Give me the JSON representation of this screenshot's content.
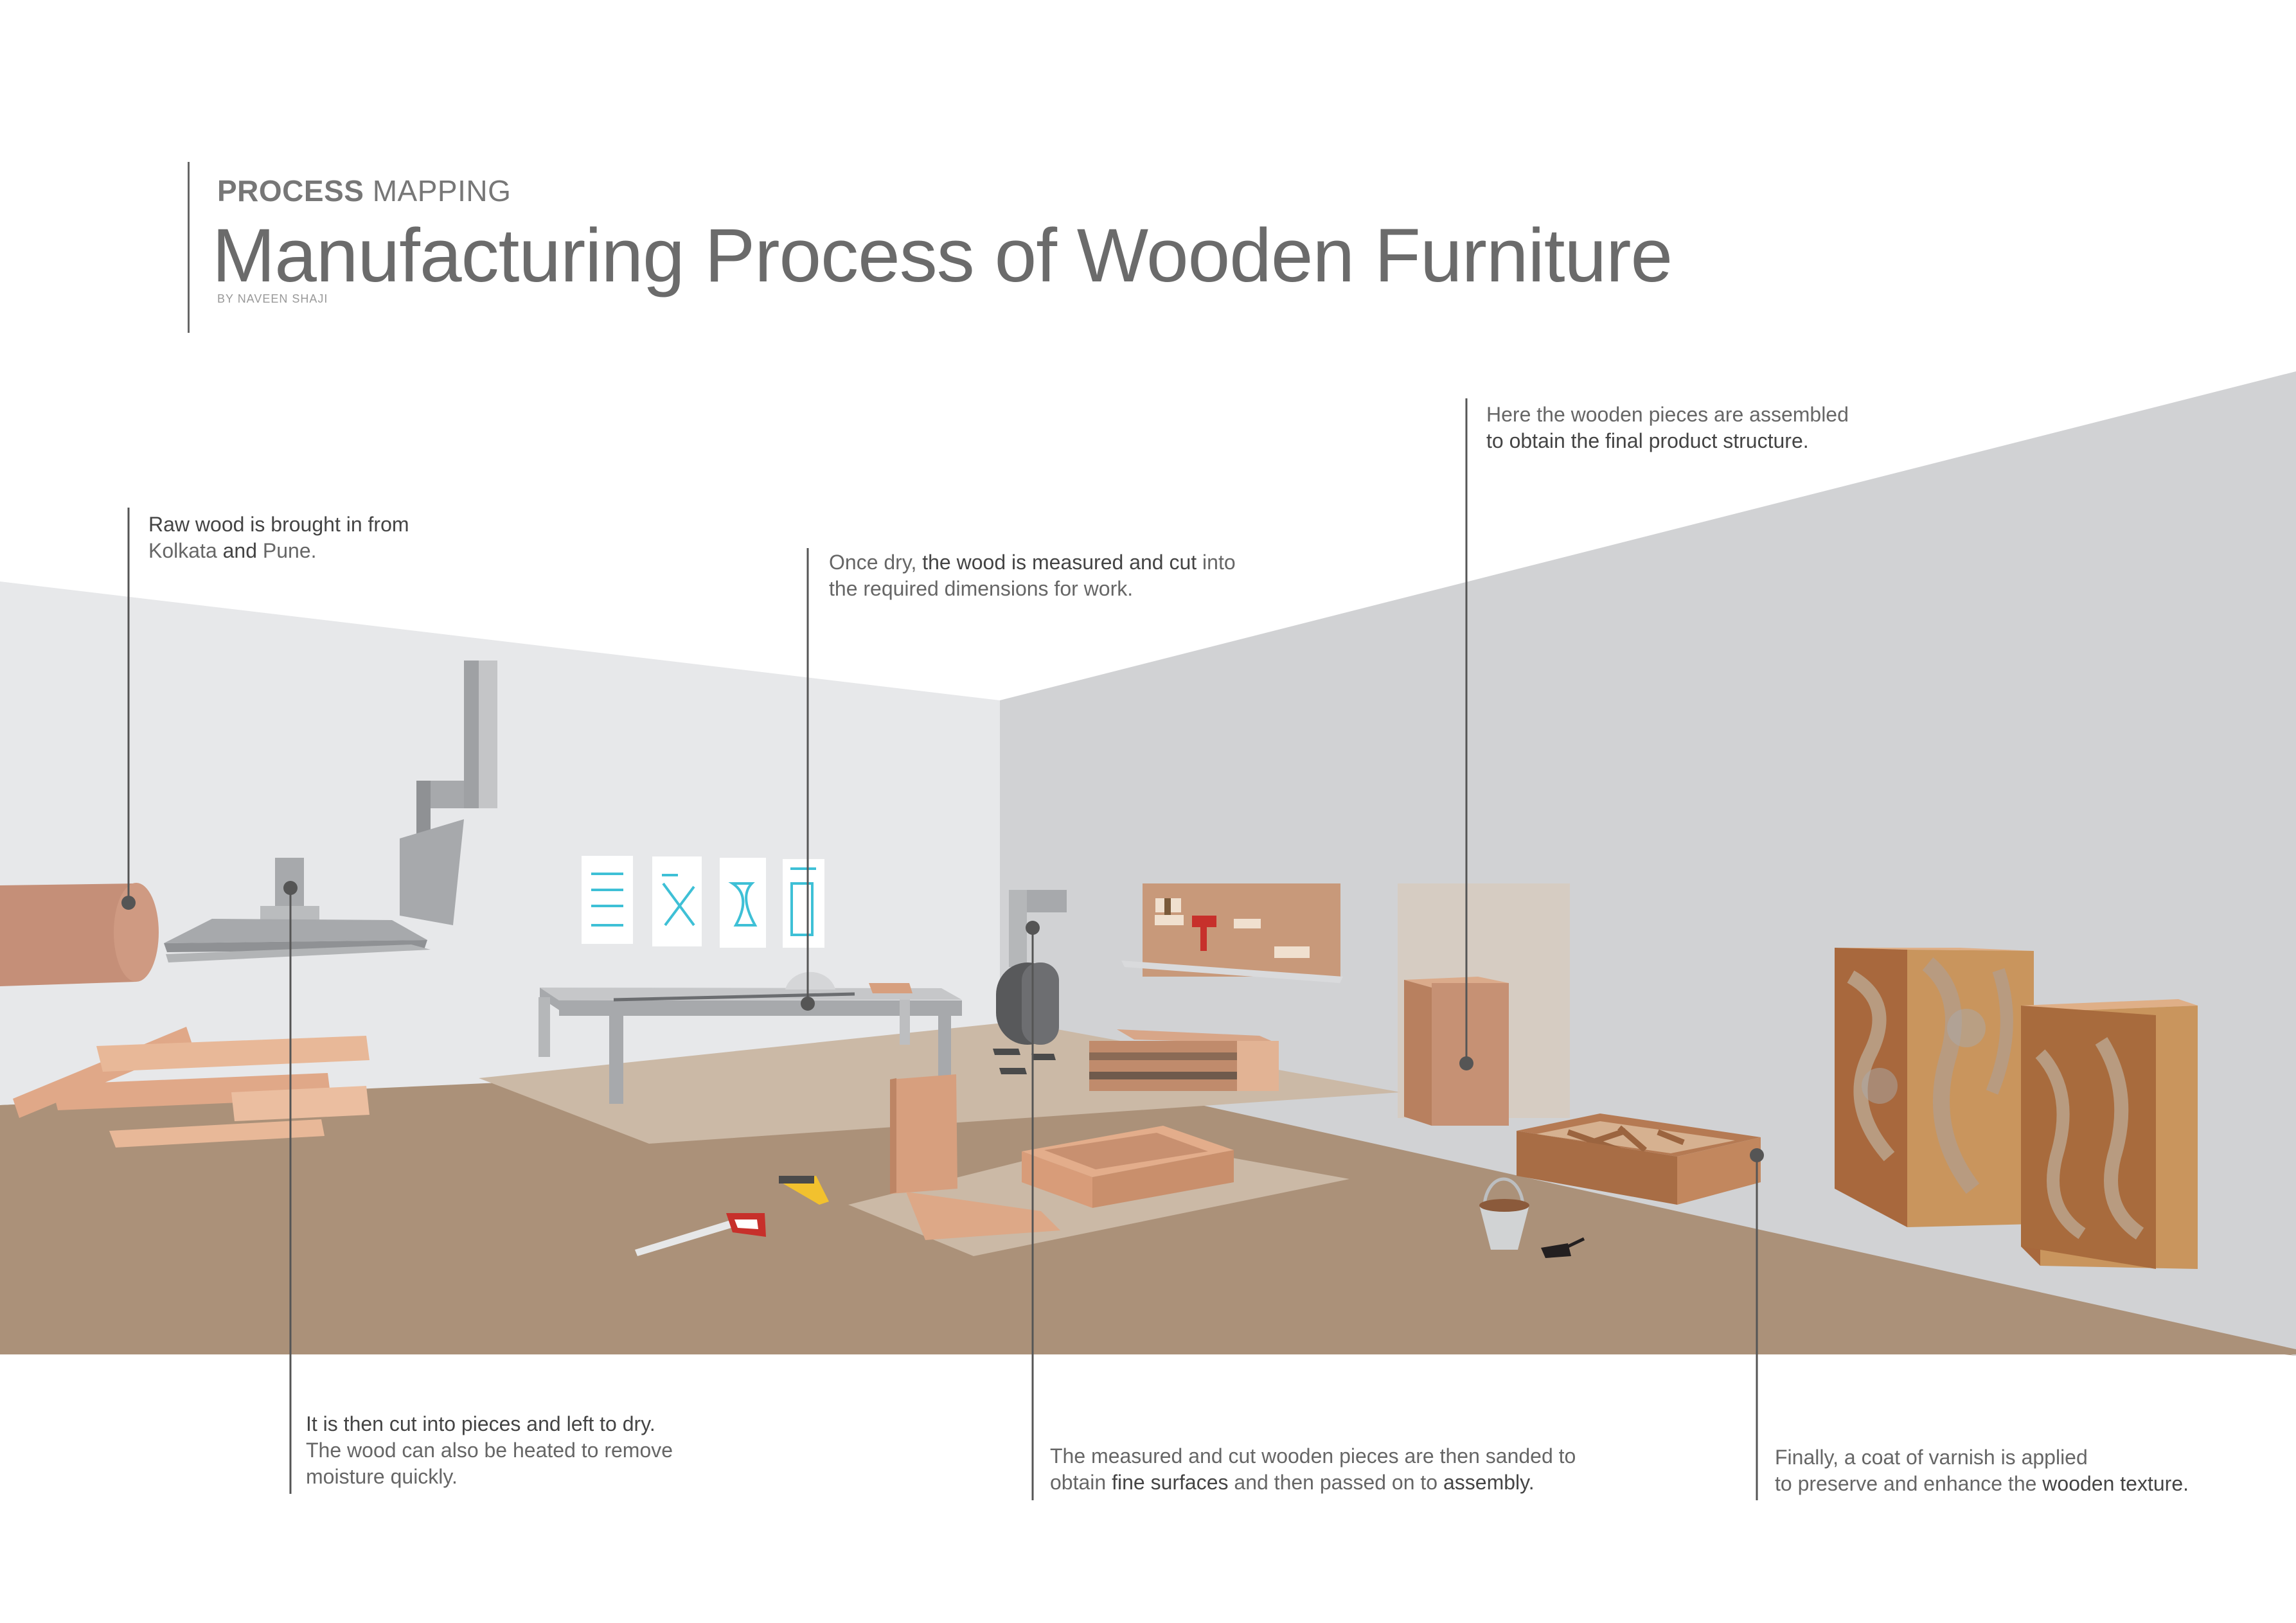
{
  "header": {
    "eyebrow_bold": "PROCESS",
    "eyebrow_rest": " MAPPING",
    "title": "Manufacturing Process of Wooden Furniture",
    "byline": "BY NAVEEN SHAJI"
  },
  "steps": [
    {
      "id": "raw-wood",
      "line1": [
        {
          "text": "Raw wood is brought in from",
          "strong": true
        }
      ],
      "line2": [
        {
          "text": "Kolkata",
          "strong": false
        },
        {
          "text": " and ",
          "strong": true
        },
        {
          "text": "Pune.",
          "strong": false
        }
      ]
    },
    {
      "id": "cut-dry",
      "line1": [
        {
          "text": "It is then cut into pieces and left to dry.",
          "strong": true
        }
      ],
      "line2": [
        {
          "text": "The wood can also be heated to remove",
          "strong": false
        }
      ],
      "line3": [
        {
          "text": "moisture quickly.",
          "strong": false
        }
      ]
    },
    {
      "id": "measure-cut",
      "line1": [
        {
          "text": "Once dry, ",
          "strong": false
        },
        {
          "text": "the wood is measured and cut",
          "strong": true
        },
        {
          "text": " into",
          "strong": false
        }
      ],
      "line2": [
        {
          "text": "the required dimensions for work.",
          "strong": false
        }
      ]
    },
    {
      "id": "sanding",
      "line1": [
        {
          "text": "The measured and cut wooden pieces are then sanded to",
          "strong": false
        }
      ],
      "line2": [
        {
          "text": "obtain ",
          "strong": false
        },
        {
          "text": "fine surfaces",
          "strong": true
        },
        {
          "text": " and then passed on to ",
          "strong": false
        },
        {
          "text": "assembly.",
          "strong": true
        }
      ]
    },
    {
      "id": "assembly",
      "line1": [
        {
          "text": "Here the wooden pieces are assembled",
          "strong": false
        }
      ],
      "line2": [
        {
          "text": "to obtain the final product structure.",
          "strong": true
        }
      ]
    },
    {
      "id": "varnish",
      "line1": [
        {
          "text": "Finally, a coat of varnish is applied",
          "strong": false
        }
      ],
      "line2": [
        {
          "text": "to preserve and enhance the ",
          "strong": false
        },
        {
          "text": "wooden texture.",
          "strong": true
        }
      ]
    }
  ],
  "colors": {
    "floor": "#ab9179",
    "rug": "#cbb9a6",
    "left_wall": "#e7e8ea",
    "right_wall": "#d1d2d4",
    "log": "#c58f78",
    "plank": "#e8b898",
    "machine": "#a7a9ac",
    "callout_line": "#555555",
    "cabinet": "#ae6e45",
    "blueprint": "#3ec0d6"
  }
}
